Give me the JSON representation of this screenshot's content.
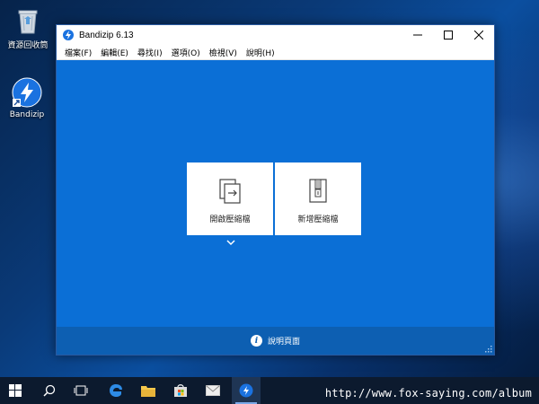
{
  "desktop": {
    "icons": [
      {
        "label": "資源回收筒",
        "icon": "recycle-bin-icon"
      },
      {
        "label": "Bandizip",
        "icon": "bandizip-app-icon"
      }
    ]
  },
  "window": {
    "title": "Bandizip 6.13",
    "controls": [
      "minimize",
      "maximize",
      "close"
    ],
    "menu": [
      "檔案(F)",
      "編輯(E)",
      "尋找(I)",
      "選項(O)",
      "檢視(V)",
      "說明(H)"
    ],
    "actions": [
      {
        "label": "開啟壓縮檔",
        "icon": "open-archive-icon"
      },
      {
        "label": "新增壓縮檔",
        "icon": "new-archive-icon"
      }
    ],
    "help_label": "說明頁面"
  },
  "taskbar": {
    "items": [
      "start-icon",
      "search-icon",
      "task-view-icon",
      "edge-icon",
      "file-explorer-icon",
      "store-icon",
      "mail-icon",
      "bandizip-taskbar-icon"
    ]
  },
  "watermark": "http://www.fox-saying.com/album",
  "colors": {
    "accent": "#0b6fd6",
    "bottom_bar": "#0d5fb2",
    "taskbar": "#0c1a2e"
  }
}
